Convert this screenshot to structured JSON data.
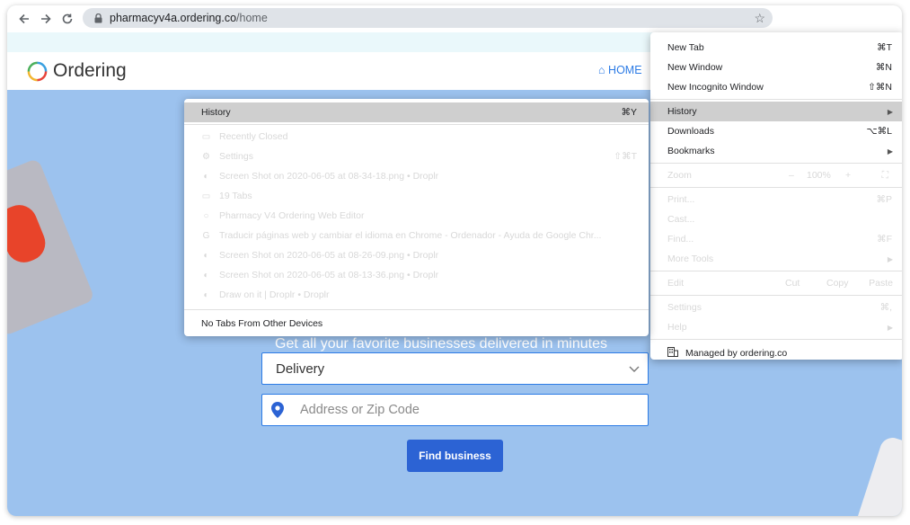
{
  "browser": {
    "url_domain": "pharmacyv4a.ordering.co",
    "url_path": "/home"
  },
  "site": {
    "logo_text": "Ordering",
    "nav_home": "HOME",
    "tagline": "Get all your favorite businesses delivered in minutes",
    "delivery_select": "Delivery",
    "address_placeholder": "Address or Zip Code",
    "find_button": "Find business",
    "colors": {
      "accent": "#2c7be5",
      "button": "#2c63d4",
      "hero": "#9cc2ee"
    }
  },
  "chrome_menu": {
    "new_tab": {
      "label": "New Tab",
      "shortcut": "⌘T"
    },
    "new_window": {
      "label": "New Window",
      "shortcut": "⌘N"
    },
    "new_incognito": {
      "label": "New Incognito Window",
      "shortcut": "⇧⌘N"
    },
    "history": {
      "label": "History"
    },
    "downloads": {
      "label": "Downloads",
      "shortcut": "⌥⌘L"
    },
    "bookmarks": {
      "label": "Bookmarks"
    },
    "zoom": {
      "label": "Zoom",
      "minus": "–",
      "level": "100%",
      "plus": "+"
    },
    "print": {
      "label": "Print...",
      "shortcut": "⌘P"
    },
    "cast": {
      "label": "Cast..."
    },
    "find": {
      "label": "Find...",
      "shortcut": "⌘F"
    },
    "more_tools": {
      "label": "More Tools"
    },
    "edit": {
      "label": "Edit",
      "cut": "Cut",
      "copy": "Copy",
      "paste": "Paste"
    },
    "settings": {
      "label": "Settings",
      "shortcut": "⌘,"
    },
    "help": {
      "label": "Help"
    },
    "managed": {
      "label": "Managed by ordering.co"
    }
  },
  "history_menu": {
    "header": {
      "label": "History",
      "shortcut": "⌘Y"
    },
    "items": [
      {
        "label": "Recently Closed",
        "icon": "folder-icon"
      },
      {
        "label": "Settings",
        "shortcut": "⇧⌘T",
        "icon": "gear-icon"
      },
      {
        "label": "Screen Shot on 2020-06-05 at 08-34-18.png • Droplr",
        "icon": "droplr-icon"
      },
      {
        "label": "19 Tabs",
        "icon": "folder-icon"
      },
      {
        "label": "Pharmacy V4 Ordering Web  Editor",
        "icon": "ordering-icon"
      },
      {
        "label": "Traducir páginas web y cambiar el idioma en Chrome - Ordenador - Ayuda de Google Chr...",
        "icon": "google-icon"
      },
      {
        "label": "Screen Shot on 2020-06-05 at 08-26-09.png • Droplr",
        "icon": "droplr-icon"
      },
      {
        "label": "Screen Shot on 2020-06-05 at 08-13-36.png • Droplr",
        "icon": "droplr-icon"
      },
      {
        "label": "Draw on it | Droplr • Droplr",
        "icon": "droplr-icon"
      }
    ],
    "footer": {
      "label": "No Tabs From Other Devices"
    }
  }
}
